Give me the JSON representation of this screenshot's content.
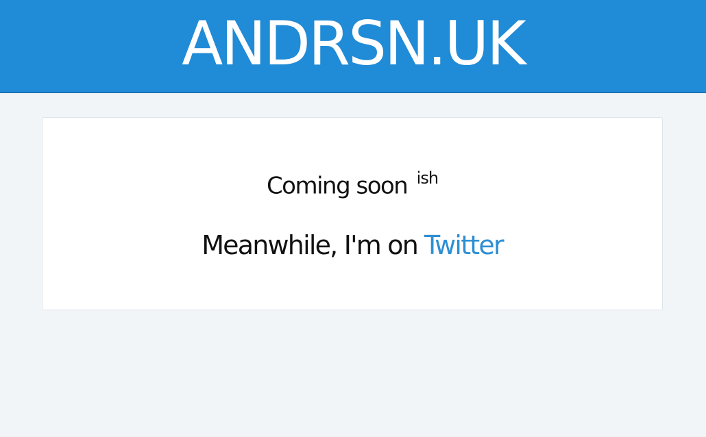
{
  "header": {
    "title": "ANDRSN.UK"
  },
  "main": {
    "coming_soon": "Coming soon",
    "coming_soon_suffix": "ish",
    "meanwhile": "Meanwhile, I'm on",
    "twitter_link": "Twitter"
  },
  "colors": {
    "header_background": "#208bd6",
    "page_background": "#f1f5f8",
    "card_background": "#ffffff",
    "link": "#2e8fd3",
    "text": "#111111"
  }
}
